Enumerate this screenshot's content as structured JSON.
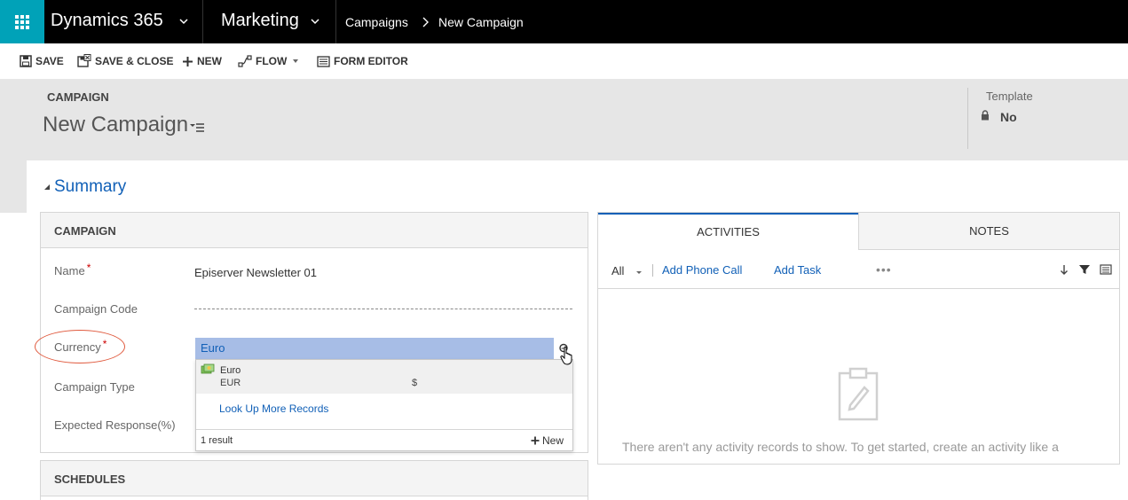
{
  "topbar": {
    "app_title": "Dynamics 365",
    "area_title": "Marketing",
    "breadcrumb": [
      "Campaigns",
      "New Campaign"
    ],
    "waffle_color": "#00a2b8"
  },
  "commands": [
    {
      "label": "SAVE",
      "icon": "save-icon"
    },
    {
      "label": "SAVE & CLOSE",
      "icon": "save-close-icon"
    },
    {
      "label": "NEW",
      "icon": "plus-icon"
    },
    {
      "label": "FLOW",
      "icon": "flow-icon"
    },
    {
      "label": "FORM EDITOR",
      "icon": "form-editor-icon"
    }
  ],
  "header": {
    "entity": "CAMPAIGN",
    "record_name": "New Campaign",
    "template_label": "Template",
    "template_value": "No"
  },
  "summary": {
    "title": "Summary",
    "campaign_section": "CAMPAIGN",
    "fields": {
      "name_label": "Name",
      "name_value": "Episerver Newsletter 01",
      "campaign_code_label": "Campaign Code",
      "currency_label": "Currency",
      "campaign_type_label": "Campaign Type",
      "expected_response_label": "Expected Response(%)"
    },
    "required_mark": "*",
    "schedules_section": "SCHEDULES"
  },
  "lookup": {
    "input_value": "Euro",
    "results": [
      {
        "name": "Euro",
        "code": "EUR",
        "symbol": "$"
      }
    ],
    "look_up_more": "Look Up More Records",
    "result_count": "1 result",
    "new_label": "New"
  },
  "activities": {
    "tab_activities": "ACTIVITIES",
    "tab_notes": "NOTES",
    "filter": "All",
    "add_phone_call": "Add Phone Call",
    "add_task": "Add Task",
    "more": "•••",
    "empty_text": "There aren't any activity records to show. To get started, create an activity like a"
  },
  "colors": {
    "accent": "#1160b7",
    "highlight": "#a7bde6",
    "annotation": "#e05a3e"
  }
}
